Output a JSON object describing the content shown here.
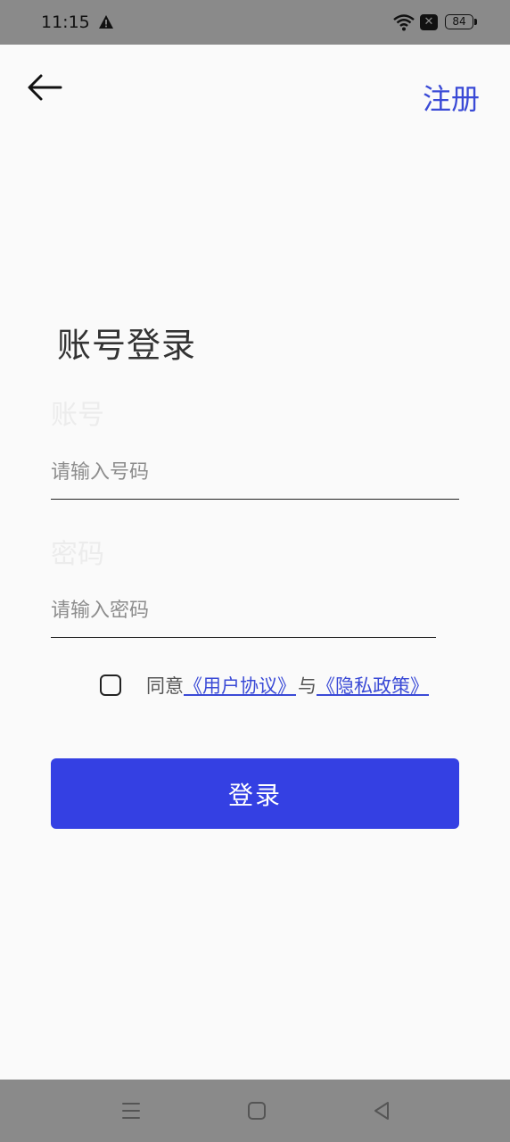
{
  "status_bar": {
    "time": "11:15",
    "battery": "84",
    "icons": [
      "warning-icon",
      "wifi-icon",
      "no-sim-icon",
      "battery-icon"
    ]
  },
  "header": {
    "back_icon": "arrow-left-icon",
    "register_label": "注册"
  },
  "login": {
    "title": "账号登录",
    "account_label": "账号",
    "account_placeholder": "请输入号码",
    "account_value": "",
    "password_label": "密码",
    "password_placeholder": "请输入密码",
    "password_value": ""
  },
  "agreement": {
    "checked": false,
    "prefix": "同意",
    "user_agreement": "《用户协议》",
    "conjunction": "与",
    "privacy_policy": "《隐私政策》"
  },
  "actions": {
    "login_label": "登录"
  },
  "nav_bar": {
    "icons": [
      "menu-icon",
      "home-icon",
      "back-triangle-icon"
    ]
  },
  "colors": {
    "accent": "#3440e3",
    "link": "#3a4ad6",
    "status_bar_bg": "#8a8a8a",
    "page_bg": "#fafafa"
  }
}
